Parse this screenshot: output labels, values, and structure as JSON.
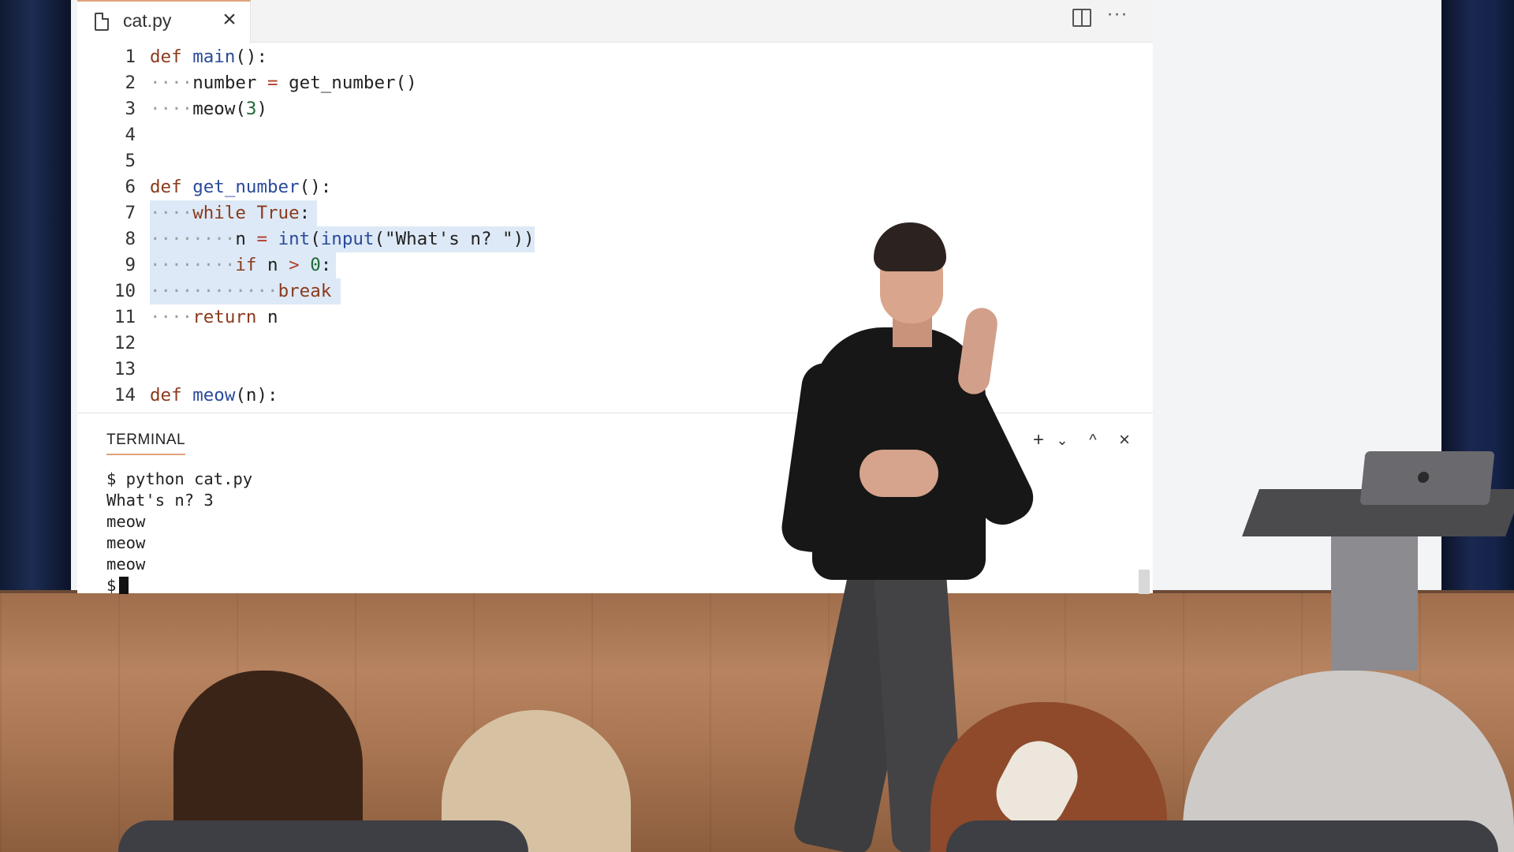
{
  "editor": {
    "tab_label": "cat.py",
    "tab_close_icon": "close-icon",
    "actions": [
      "split-editor-icon",
      "more-actions-icon"
    ]
  },
  "code_lines": [
    {
      "n": "1",
      "text": "def main():"
    },
    {
      "n": "2",
      "text": "····number = get_number()"
    },
    {
      "n": "3",
      "text": "····meow(3)"
    },
    {
      "n": "4",
      "text": ""
    },
    {
      "n": "5",
      "text": ""
    },
    {
      "n": "6",
      "text": "def get_number():"
    },
    {
      "n": "7",
      "text": "····while True:"
    },
    {
      "n": "8",
      "text": "········n = int(input(\"What's n? \"))"
    },
    {
      "n": "9",
      "text": "········if n > 0:"
    },
    {
      "n": "10",
      "text": "············break"
    },
    {
      "n": "11",
      "text": "····return n"
    },
    {
      "n": "12",
      "text": ""
    },
    {
      "n": "13",
      "text": ""
    },
    {
      "n": "14",
      "text": "def meow(n):"
    }
  ],
  "terminal": {
    "tab_label": "TERMINAL",
    "lines": [
      "$ python cat.py",
      "What's n? 3",
      "meow",
      "meow",
      "meow",
      "$"
    ],
    "controls": [
      "add-terminal-icon",
      "chevron-down-icon",
      "maximize-panel-icon",
      "close-panel-icon"
    ]
  },
  "colors": {
    "keyword": "#8b3a1c",
    "function": "#2a4a9a",
    "operator": "#b33c2a",
    "number": "#1f6a33",
    "selection": "#dde9f6",
    "tab_accent": "#e0a27a"
  }
}
